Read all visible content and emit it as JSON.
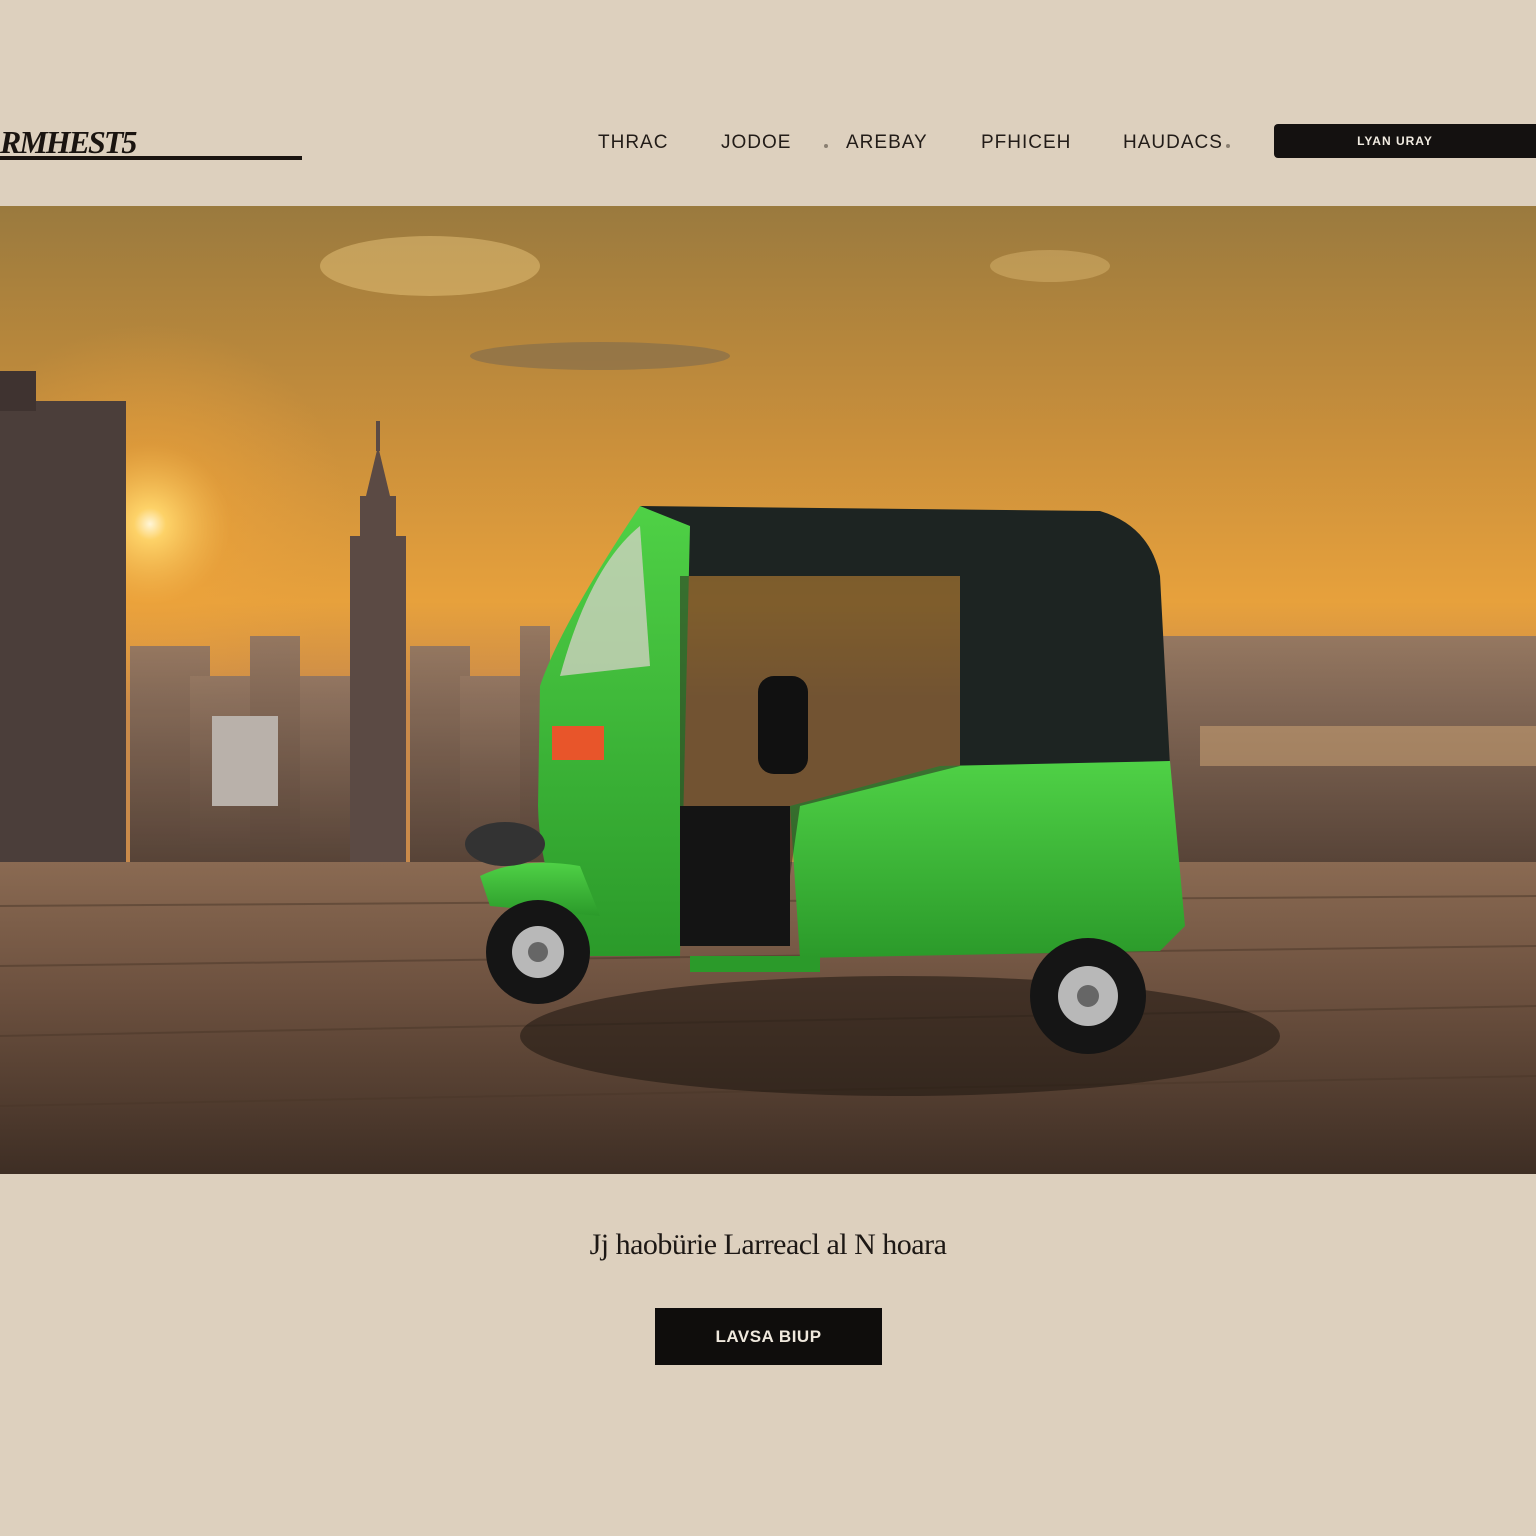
{
  "header": {
    "logo_text": "RMHEST5",
    "nav": [
      {
        "label": "THRAC"
      },
      {
        "label": "JODOE"
      },
      {
        "label": "AREBAY"
      },
      {
        "label": "PFHICEH"
      },
      {
        "label": "HAUDACS"
      }
    ],
    "cta_label": "LYAN URAY"
  },
  "hero": {
    "image_subject": "green auto-rickshaw on a rooftop against a sunset city skyline"
  },
  "main": {
    "tagline": "Jj haobürie Larreacl al N hoara",
    "cta_label": "LAVSA BIUP"
  },
  "colors": {
    "page_background": "#ddd0be",
    "button_dark": "#0f0d0c",
    "rickshaw_green": "#3fbf38",
    "sky_orange": "#e09a3a"
  }
}
